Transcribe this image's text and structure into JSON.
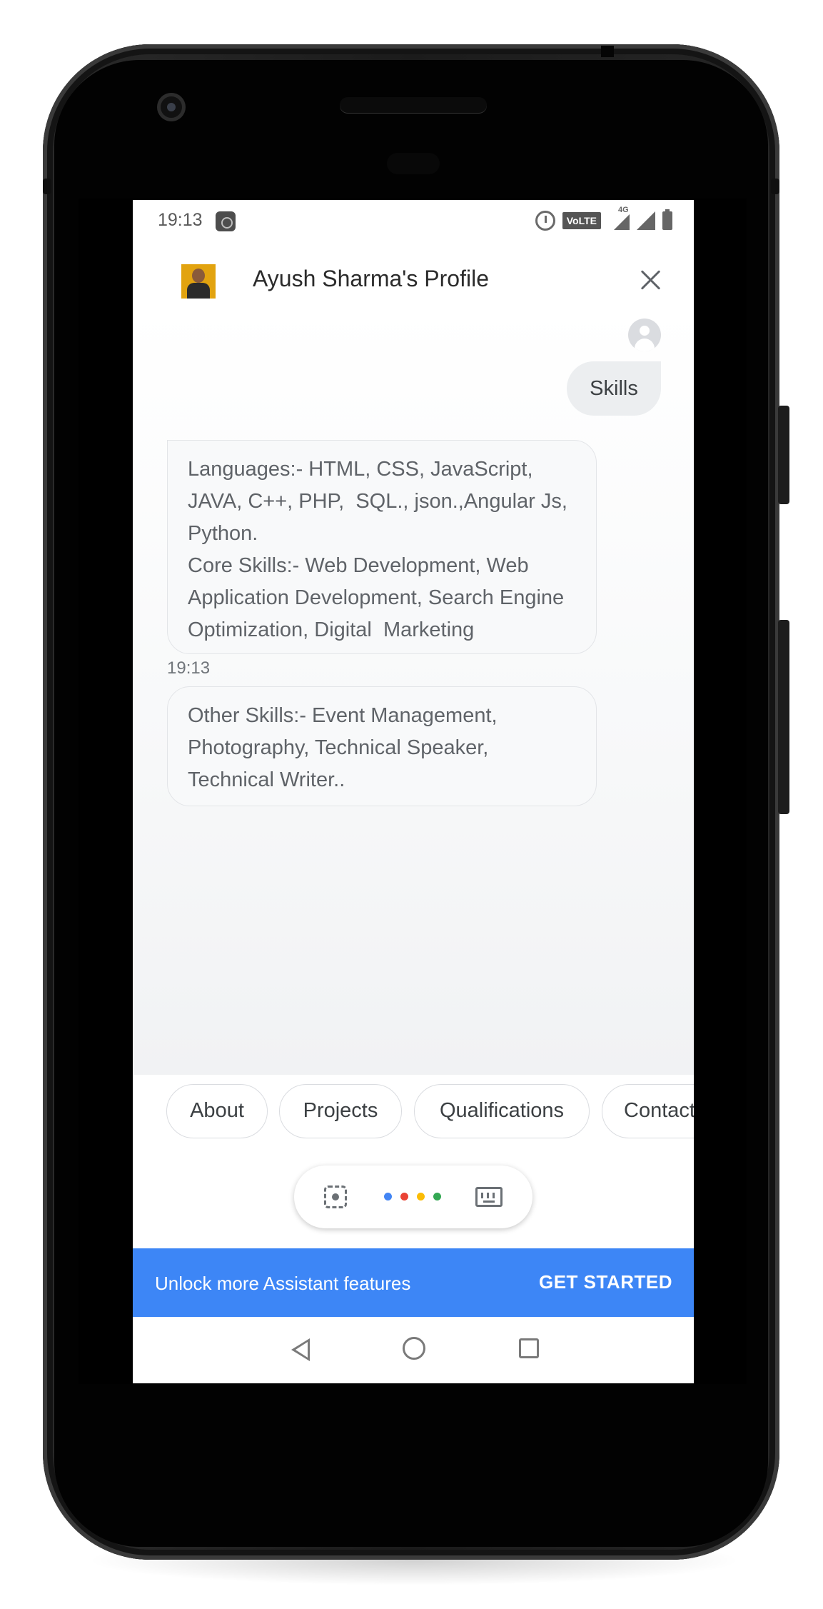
{
  "status_bar": {
    "time": "19:13",
    "volte_label": "VoLTE",
    "network_label": "4G"
  },
  "header": {
    "title": "Ayush Sharma's Profile"
  },
  "chat": {
    "user_message": "Skills",
    "bot_messages": [
      {
        "text": "Languages:- HTML, CSS, JavaScript, JAVA, C++, PHP,  SQL., json.,Angular Js, Python.\nCore Skills:- Web Development, Web Application Development, Search Engine Optimization, Digital  Marketing"
      },
      {
        "text": "Other Skills:- Event Management, Photography, Technical Speaker, Technical Writer.."
      }
    ],
    "timestamp": "19:13"
  },
  "suggestion_chips": [
    "About",
    "Projects",
    "Qualifications",
    "Contact"
  ],
  "input_bar": {
    "dot_colors": [
      "#4285f4",
      "#ea4335",
      "#fbbc05",
      "#34a853"
    ]
  },
  "promo": {
    "text": "Unlock more Assistant features",
    "button_label": "GET STARTED",
    "background_color": "#3d86f6"
  }
}
